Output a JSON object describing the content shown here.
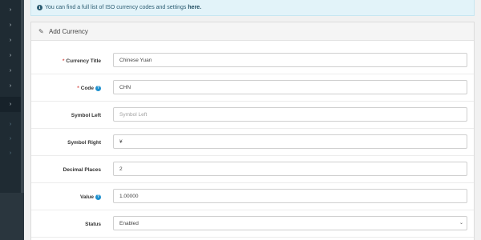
{
  "sidebar": {
    "items": [
      {
        "icon": "chevron-right-icon",
        "glyph": "›"
      },
      {
        "icon": "chevron-right-icon",
        "glyph": "›"
      },
      {
        "icon": "chevron-right-icon",
        "glyph": "›"
      },
      {
        "icon": "chevron-right-icon",
        "glyph": "›"
      },
      {
        "icon": "chevron-right-icon",
        "glyph": "›"
      },
      {
        "icon": "chevron-right-icon",
        "glyph": "›"
      },
      {
        "icon": "chevron-right-icon",
        "glyph": "›"
      },
      {
        "icon": "chevron-right-icon",
        "glyph": "›"
      },
      {
        "icon": "chevron-right-icon",
        "glyph": "›"
      },
      {
        "icon": "chevron-right-icon",
        "glyph": "›"
      }
    ]
  },
  "alert": {
    "icon": "info-icon",
    "icon_glyph": "i",
    "text": "You can find a full list of ISO currency codes and settings",
    "link_text": "here."
  },
  "panel": {
    "icon": "pencil-icon",
    "icon_glyph": "✎",
    "title": "Add Currency"
  },
  "form": {
    "title": {
      "label": "Currency Title",
      "required": "*",
      "value": "Chinese Yuan",
      "placeholder": "Currency Title"
    },
    "code": {
      "label": "Code",
      "required": "*",
      "help_glyph": "?",
      "value": "CHN",
      "placeholder": "Code"
    },
    "symbol_left": {
      "label": "Symbol Left",
      "value": "",
      "placeholder": "Symbol Left"
    },
    "symbol_right": {
      "label": "Symbol Right",
      "value": "¥",
      "placeholder": "Symbol Right"
    },
    "decimal_places": {
      "label": "Decimal Places",
      "value": "2",
      "placeholder": "Decimal Places"
    },
    "value": {
      "label": "Value",
      "help_glyph": "?",
      "value": "1.00000",
      "placeholder": "Value"
    },
    "status": {
      "label": "Status",
      "selected": "Enabled",
      "chevron_glyph": "⌄"
    }
  },
  "colors": {
    "sidebar": "#1f2b33",
    "alert_bg": "#e2f3f9",
    "required": "#d9534f",
    "help": "#1e91cf"
  }
}
